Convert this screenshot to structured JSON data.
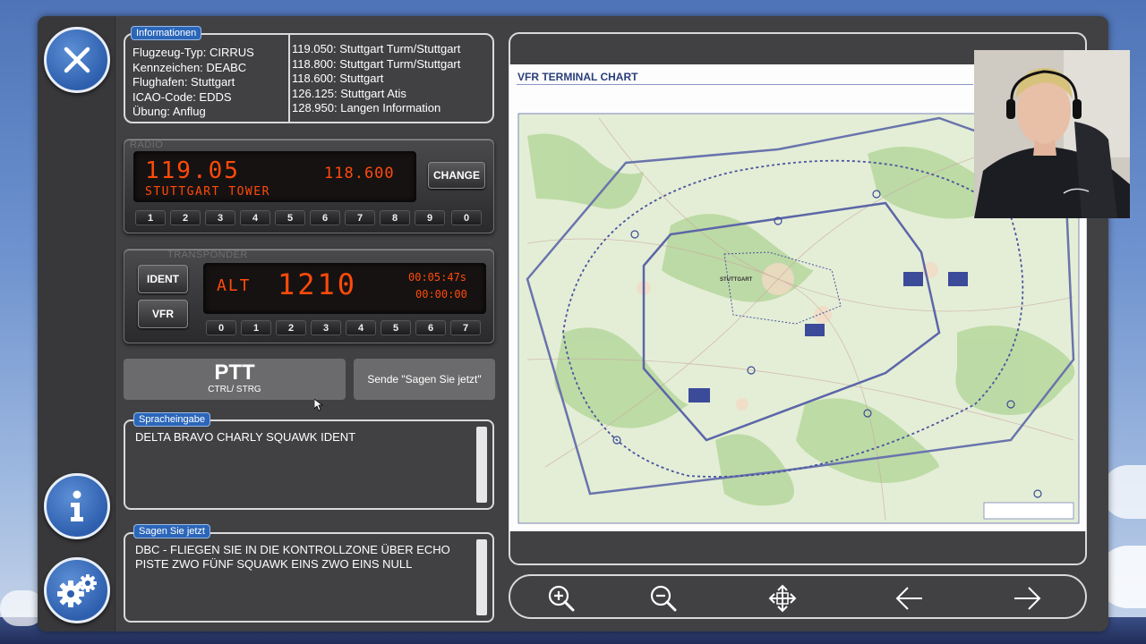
{
  "info": {
    "legend": "Informationen",
    "lines": [
      "Flugzeug-Typ: CIRRUS",
      "Kennzeichen: DEABC",
      "Flughafen: Stuttgart",
      "ICAO-Code: EDDS",
      "Übung: Anflug"
    ],
    "frequencies": [
      "119.050: Stuttgart Turm/Stuttgart",
      "118.800: Stuttgart Turm/Stuttgart",
      "118.600: Stuttgart",
      "126.125: Stuttgart Atis",
      "128.950: Langen Information"
    ]
  },
  "radio": {
    "title": "RADIO",
    "active_freq": "119.05",
    "standby_freq": "118.600",
    "station": "STUTTGART TOWER",
    "change_label": "CHANGE",
    "keys": [
      "1",
      "2",
      "3",
      "4",
      "5",
      "6",
      "7",
      "8",
      "9",
      "0"
    ]
  },
  "transponder": {
    "title": "TRANSPONDER",
    "ident_label": "IDENT",
    "vfr_label": "VFR",
    "mode": "ALT",
    "code": "1210",
    "timer1": "00:05:47s",
    "timer2": "00:00:00",
    "keys": [
      "0",
      "1",
      "2",
      "3",
      "4",
      "5",
      "6",
      "7"
    ]
  },
  "ptt": {
    "label": "PTT",
    "sub": "CTRL/ STRG"
  },
  "sende_label": "Sende \"Sagen Sie jetzt\"",
  "spracheingabe": {
    "legend": "Spracheingabe",
    "text": "DELTA BRAVO CHARLY SQUAWK IDENT"
  },
  "sagen": {
    "legend": "Sagen Sie jetzt",
    "line1": "DBC - FLIEGEN SIE IN DIE KONTROLLZONE ÜBER ECHO",
    "line2": "PISTE ZWO FÜNF SQUAWK EINS ZWO EINS NULL"
  },
  "chart": {
    "title": "VFR TERMINAL CHART",
    "city": "STUTTGART"
  },
  "toolbar": {
    "icons": [
      "zoom-in-icon",
      "zoom-out-icon",
      "move-icon",
      "arrow-left-icon",
      "arrow-right-icon"
    ]
  },
  "colors": {
    "accent": "#2b66b9",
    "lcd_text": "#ff4a0a",
    "panel": "#414144"
  }
}
